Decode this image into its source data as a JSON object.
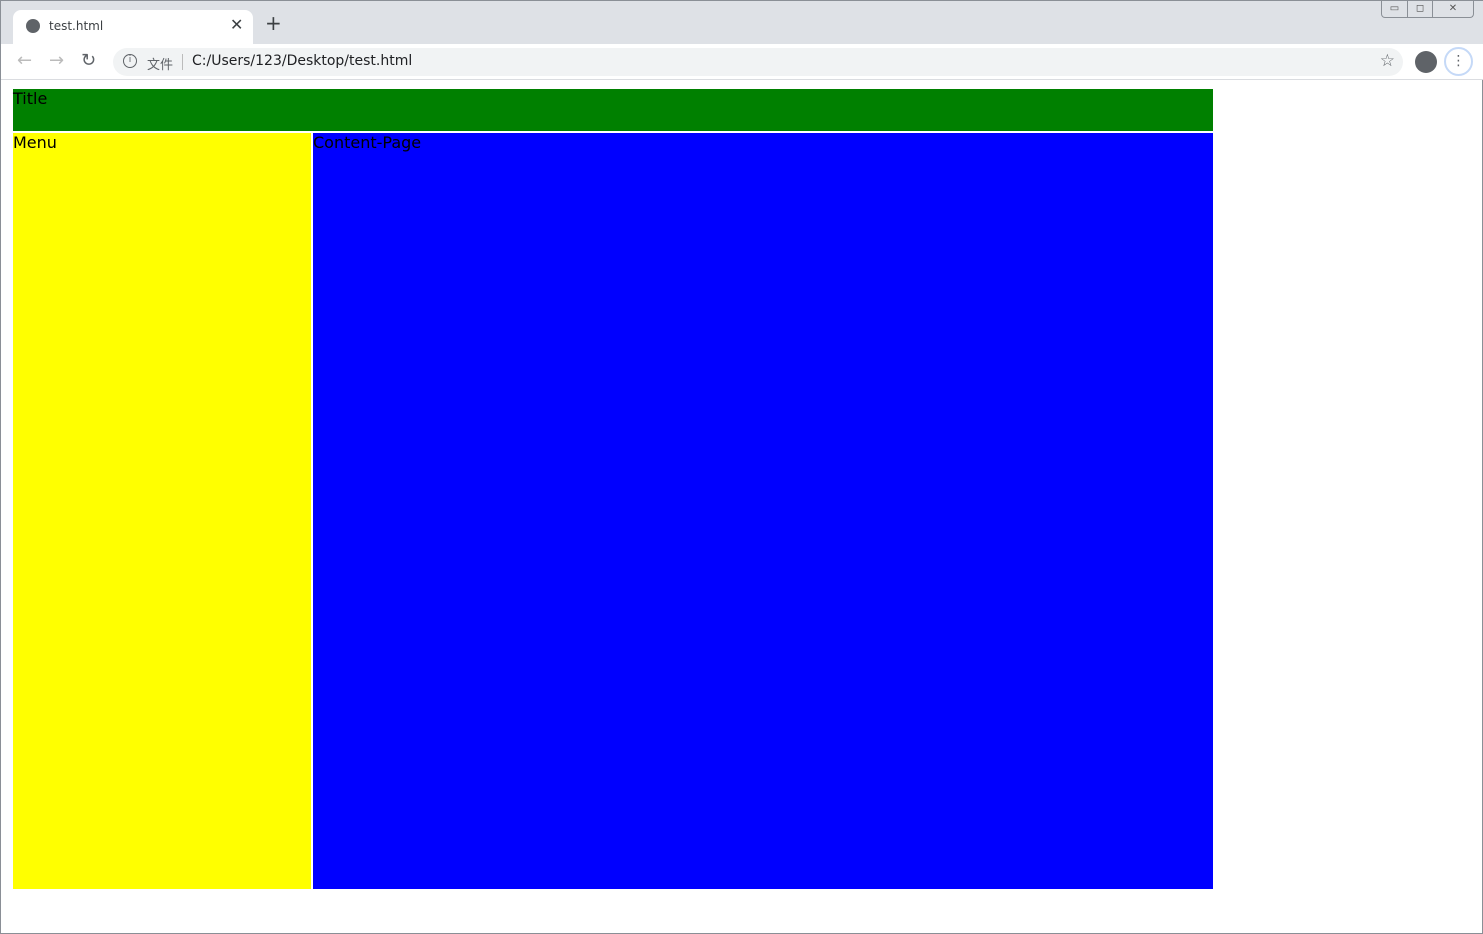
{
  "browser": {
    "tab_title": "test.html",
    "close_tab": "✕",
    "new_tab": "+",
    "omnibox": {
      "security_label": "文件",
      "url": "C:/Users/123/Desktop/test.html"
    },
    "icons": [
      "globe-icon",
      "back-icon",
      "forward-icon",
      "reload-icon",
      "info-icon",
      "star-icon",
      "profile-icon",
      "kebab-menu-icon"
    ]
  },
  "page": {
    "title": "Title",
    "menu": "Menu",
    "content": "Content-Page",
    "colors": {
      "header": "#008000",
      "menu": "#ffff00",
      "content": "#0000ff"
    }
  }
}
